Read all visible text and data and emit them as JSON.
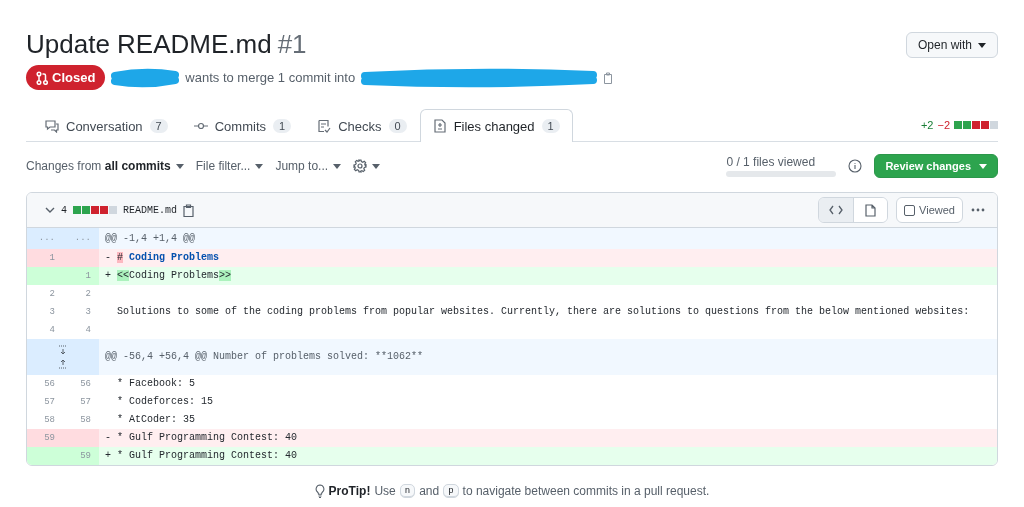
{
  "title": "Update README.md",
  "number": "#1",
  "open_with": "Open with",
  "status": {
    "kind": "closed",
    "label": "Closed"
  },
  "merge_text": "wants to merge 1 commit into",
  "tabs": [
    {
      "kind": "conversation",
      "label": "Conversation",
      "count": "7",
      "selected": false
    },
    {
      "kind": "commits",
      "label": "Commits",
      "count": "1",
      "selected": false
    },
    {
      "kind": "checks",
      "label": "Checks",
      "count": "0",
      "selected": false
    },
    {
      "kind": "files",
      "label": "Files changed",
      "count": "1",
      "selected": true
    }
  ],
  "diffstat": {
    "additions": "+2",
    "deletions": "−2",
    "blocks": [
      {
        "color": "#2da44e"
      },
      {
        "color": "#2da44e"
      },
      {
        "color": "#cf222e"
      },
      {
        "color": "#cf222e"
      },
      {
        "color": "#d0d7de"
      }
    ]
  },
  "toolbar": {
    "changes": "Changes from **all commits**",
    "menus": [
      "File filter...",
      "Jump to..."
    ],
    "files_viewed": {
      "text": "0 / 1 files viewed",
      "level": 0
    },
    "review_button": "Review changes"
  },
  "file": {
    "expanded": true,
    "changes": "4",
    "blocks": [
      {
        "color": "#2da44e"
      },
      {
        "color": "#2da44e"
      },
      {
        "color": "#cf222e"
      },
      {
        "color": "#cf222e"
      },
      {
        "color": "#d0d7de"
      }
    ],
    "name": "README.md",
    "view_modes": [
      {
        "kind": "source",
        "selected": true
      },
      {
        "kind": "rich",
        "selected": false
      }
    ],
    "viewed": false,
    "viewed_label": "Viewed",
    "lines": [
      {
        "kind": "hunk",
        "old": "...",
        "new": "...",
        "text": "@@ -1,4 +1,4 @@"
      },
      {
        "kind": "del",
        "old": "1",
        "sign": "-",
        "segments": [
          {
            "kind": "highlight",
            "text": "#"
          },
          {
            "kind": "heading",
            "text": " Coding Problems"
          }
        ]
      },
      {
        "kind": "add",
        "new": "1",
        "sign": "+",
        "segments": [
          {
            "kind": "highlight",
            "text": "<<"
          },
          {
            "kind": "plain",
            "text": "Coding Problems"
          },
          {
            "kind": "highlight",
            "text": ">>"
          }
        ]
      },
      {
        "kind": "context",
        "old": "2",
        "new": "2"
      },
      {
        "kind": "context",
        "old": "3",
        "new": "3",
        "text": "Solutions to some of the coding problems from popular websites. Currently, there are solutions to questions from the below mentioned websites:"
      },
      {
        "kind": "context",
        "old": "4",
        "new": "4"
      },
      {
        "kind": "expand",
        "text": "@@ -56,4 +56,4 @@ Number of problems solved: **1062**"
      },
      {
        "kind": "context",
        "old": "56",
        "new": "56",
        "text": "* Facebook: 5"
      },
      {
        "kind": "context",
        "old": "57",
        "new": "57",
        "text": "* Codeforces: 15"
      },
      {
        "kind": "context",
        "old": "58",
        "new": "58",
        "text": "* AtCoder: 35"
      },
      {
        "kind": "del",
        "old": "59",
        "sign": "-",
        "segments": [
          {
            "kind": "plain",
            "text": "* Gulf Programming Contest: 40"
          }
        ]
      },
      {
        "kind": "add",
        "new": "59",
        "sign": "+",
        "segments": [
          {
            "kind": "plain",
            "text": "* Gulf Programming Contest: 40"
          }
        ]
      }
    ]
  },
  "protip": {
    "label": "ProTip!",
    "parts": [
      {
        "kind": "text",
        "text": "Use"
      },
      {
        "kind": "key",
        "text": "n"
      },
      {
        "kind": "text",
        "text": "and"
      },
      {
        "kind": "key",
        "text": "p"
      },
      {
        "kind": "text",
        "text": "to navigate between commits in a pull request."
      }
    ]
  }
}
